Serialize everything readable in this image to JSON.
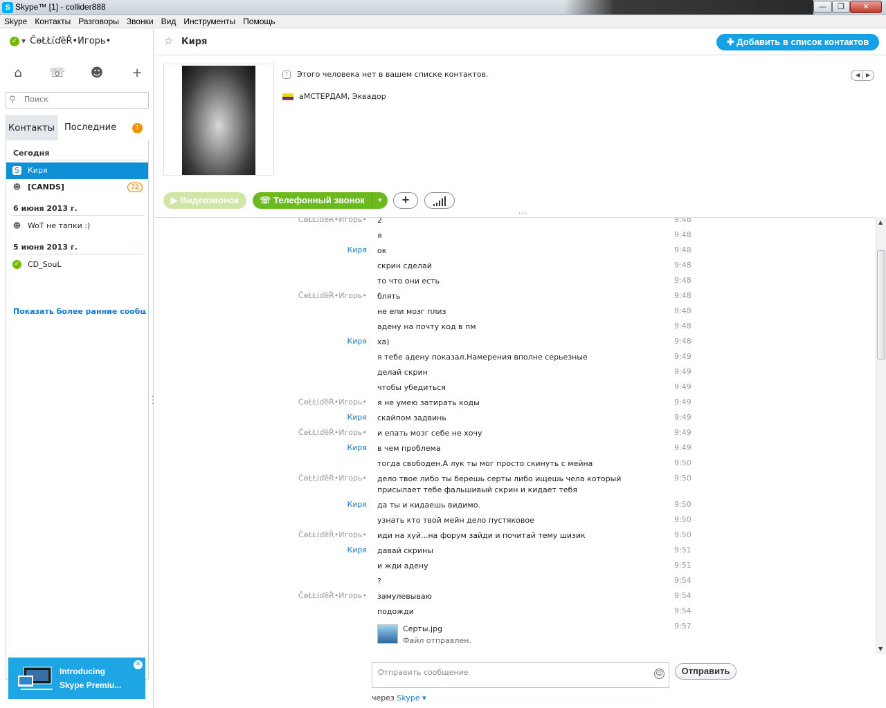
{
  "window": {
    "title": "Skype™ [1] - collider888",
    "min": "—",
    "max": "❐",
    "close": "✕"
  },
  "menu": [
    "Skype",
    "Контакты",
    "Разговоры",
    "Звонки",
    "Вид",
    "Инструменты",
    "Помощь"
  ],
  "profile": {
    "username": "ĈѳŁŁίďěŘ•Игорь•",
    "status_icon": "online-check"
  },
  "search": {
    "placeholder": "Поиск"
  },
  "tabs": {
    "contacts": "Контакты",
    "recent": "Последние",
    "recent_badge": "1"
  },
  "recent": {
    "groups": [
      {
        "date": "Сегодня",
        "items": [
          {
            "name": "Киря",
            "icon": "skype-icon",
            "selected": true
          },
          {
            "name": "[CANDS]",
            "icon": "group-icon",
            "bold": true,
            "badge": "72"
          }
        ]
      },
      {
        "date": "6 июня 2013 г.",
        "items": [
          {
            "name": "WoT не тапки :)",
            "icon": "group-icon"
          }
        ]
      },
      {
        "date": "5 июня 2013 г.",
        "items": [
          {
            "name": "CD_SouL",
            "icon": "online-check"
          }
        ]
      }
    ],
    "show_earlier": "Показать более ранние сообщ..."
  },
  "promo": {
    "line1": "Introducing",
    "line2": "Skype Premiu..."
  },
  "conversation": {
    "contact_name": "Киря",
    "add_contact": "Добавить в список контактов",
    "not_in_list": "Этого человека нет в вашем списке контактов.",
    "location": "аМСТЕРДАМ, Эквадор",
    "video_call": "Видеозвонок",
    "phone_call": "Телефонный звонок"
  },
  "messages": [
    {
      "from": "ĈѳŁŁίďěŘ•Игорь•",
      "who": "me",
      "text": "2",
      "time": "9:48"
    },
    {
      "from": "",
      "who": "me",
      "text": "я",
      "time": "9:48"
    },
    {
      "from": "Киря",
      "who": "them",
      "text": "ок",
      "time": "9:48"
    },
    {
      "from": "",
      "who": "them",
      "text": "скрин сделай",
      "time": "9:48"
    },
    {
      "from": "",
      "who": "them",
      "text": "то что они есть",
      "time": "9:48"
    },
    {
      "from": "ĈѳŁŁίďěŘ•Игорь•",
      "who": "me",
      "text": "блять",
      "time": "9:48"
    },
    {
      "from": "",
      "who": "me",
      "text": "не епи мозг плиз",
      "time": "9:48"
    },
    {
      "from": "",
      "who": "me",
      "text": "адену на почту код в пм",
      "time": "9:48"
    },
    {
      "from": "Киря",
      "who": "them",
      "text": "ха)",
      "time": "9:48"
    },
    {
      "from": "",
      "who": "them",
      "text": "я тебе адену показал.Намерения вполне серьезные",
      "time": "9:49"
    },
    {
      "from": "",
      "who": "them",
      "text": "делай скрин",
      "time": "9:49"
    },
    {
      "from": "",
      "who": "them",
      "text": "чтобы убедиться",
      "time": "9:49"
    },
    {
      "from": "ĈѳŁŁίďěŘ•Игорь•",
      "who": "me",
      "text": "я не умею затирать коды",
      "time": "9:49"
    },
    {
      "from": "Киря",
      "who": "them",
      "text": "скайпом задвинь",
      "time": "9:49"
    },
    {
      "from": "ĈѳŁŁίďěŘ•Игорь•",
      "who": "me",
      "text": "и епать мозг себе не хочу",
      "time": "9:49"
    },
    {
      "from": "Киря",
      "who": "them",
      "text": "в чем проблема",
      "time": "9:49"
    },
    {
      "from": "",
      "who": "them",
      "text": "тогда свободен.А лук ты мог просто скинуть с мейна",
      "time": "9:50"
    },
    {
      "from": "ĈѳŁŁίďěŘ•Игорь•",
      "who": "me",
      "text": "дело твое либо ты берешь серты либо ищешь чела который присылает тебе фальшивый скрин и кидает тебя",
      "time": "9:50"
    },
    {
      "from": "Киря",
      "who": "them",
      "text": "да ты и кидаешь видимо.",
      "time": "9:50"
    },
    {
      "from": "",
      "who": "them",
      "text": "узнать кто твой мейн дело пустяковое",
      "time": "9:50"
    },
    {
      "from": "ĈѳŁŁίďěŘ•Игорь•",
      "who": "me",
      "text": "иди на хуй...на форум зайди и почитай тему шизик",
      "time": "9:50"
    },
    {
      "from": "Киря",
      "who": "them",
      "text": "давай скрины",
      "time": "9:51"
    },
    {
      "from": "",
      "who": "them",
      "text": "и жди адену",
      "time": "9:51"
    },
    {
      "from": "",
      "who": "them",
      "text": "?",
      "time": "9:54"
    },
    {
      "from": "ĈѳŁŁίďěŘ•Игорь•",
      "who": "me",
      "text": "замулевываю",
      "time": "9:54"
    },
    {
      "from": "",
      "who": "me",
      "text": "подожди",
      "time": "9:54"
    }
  ],
  "file_message": {
    "name": "Серты.jpg",
    "status": "Файл отправлен.",
    "time": "9:57"
  },
  "composer": {
    "placeholder": "Отправить сообщение",
    "send": "Отправить",
    "via_prefix": "через",
    "via_link": "Skype"
  },
  "colors": {
    "accent": "#00aff0",
    "selected": "#0f8fd6",
    "call_green": "#6cb91f",
    "badge_orange": "#f39200"
  }
}
